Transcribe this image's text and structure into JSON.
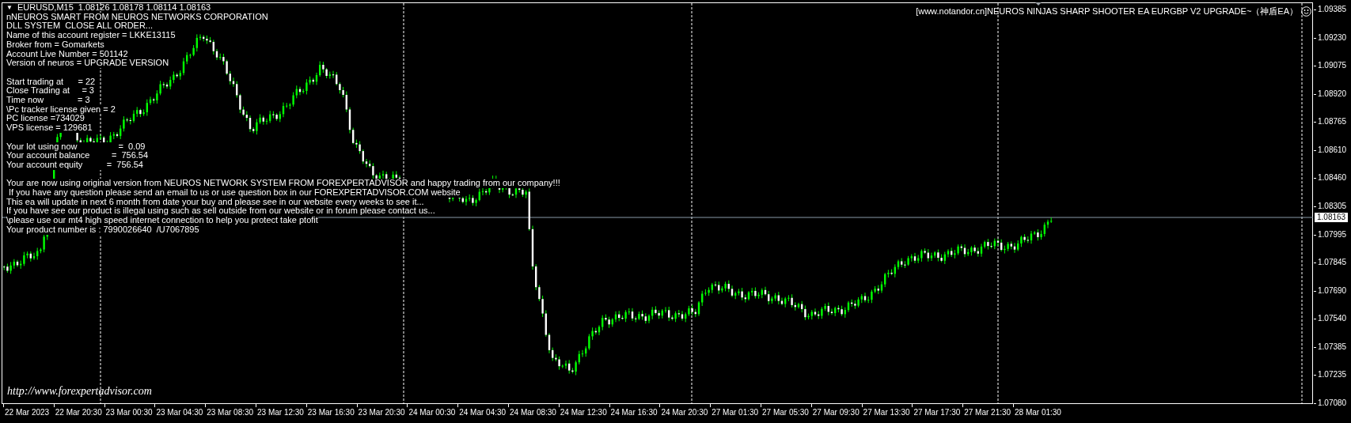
{
  "chart_header": {
    "menu_glyph": "▼",
    "symbol": "EURUSD,M15",
    "prices": "1.08126 1.08178 1.08114 1.08163"
  },
  "expert_title": "[www.notandor.cn]NEUROS NINJAS SHARP SHOOTER EA EURGBP V2 UPGRADE~（神盾EA）",
  "info_blocks": [
    [
      "nNEUROS SMART FROM NEUROS NETWORKS CORPORATION",
      "DLL SYSTEM  CLOSE ALL ORDER...",
      "Name of this account register = LKKE13115",
      "Broker from = Gomarkets",
      "Account Live Number = 501142",
      "Version of neuros = UPGRADE VERSION"
    ],
    [
      "Start trading at      = 22",
      "Close Trading at     = 3",
      "Time now              = 3",
      "\\Pc tracker license given = 2",
      "PC license =734029",
      "VPS license = 129681"
    ],
    [
      "Your lot using now                 =  0.09",
      "Your account balance         =  756.54",
      "Your account equity          =  756.54"
    ],
    [
      "Your are now using original version from NEUROS NETWORK SYSTEM FROM FOREXPERTADVISOR and happy trading from our company!!!",
      " If you have any question please send an email to us or use question box in our FOREXPERTADVISOR.COM website",
      "This ea will update in next 6 month from date your buy and please see in our website every weeks to see it...",
      "If you have see our product is illegal using such as sell outside from our website or in forum please contact us...",
      "\\please use our mt4 high speed internet connection to help you protect take ptofit",
      "Your product number is : 7990026640  /U7067895"
    ]
  ],
  "site_link": "http://www.forexpertadvisor.com",
  "price_axis": [
    "1.09385",
    "1.09230",
    "1.09075",
    "1.08920",
    "1.08765",
    "1.08610",
    "1.08460",
    "1.08305",
    "1.07995",
    "1.07845",
    "1.07690",
    "1.07540",
    "1.07385",
    "1.07235",
    "1.07080"
  ],
  "current_price": "1.08163",
  "time_axis": [
    "22 Mar 2023",
    "22 Mar 20:30",
    "23 Mar 00:30",
    "23 Mar 04:30",
    "23 Mar 08:30",
    "23 Mar 12:30",
    "23 Mar 16:30",
    "23 Mar 20:30",
    "24 Mar 00:30",
    "24 Mar 04:30",
    "24 Mar 08:30",
    "24 Mar 12:30",
    "24 Mar 16:30",
    "24 Mar 20:30",
    "27 Mar 01:30",
    "27 Mar 05:30",
    "27 Mar 09:30",
    "27 Mar 13:30",
    "27 Mar 17:30",
    "27 Mar 21:30",
    "28 Mar 01:30"
  ]
}
